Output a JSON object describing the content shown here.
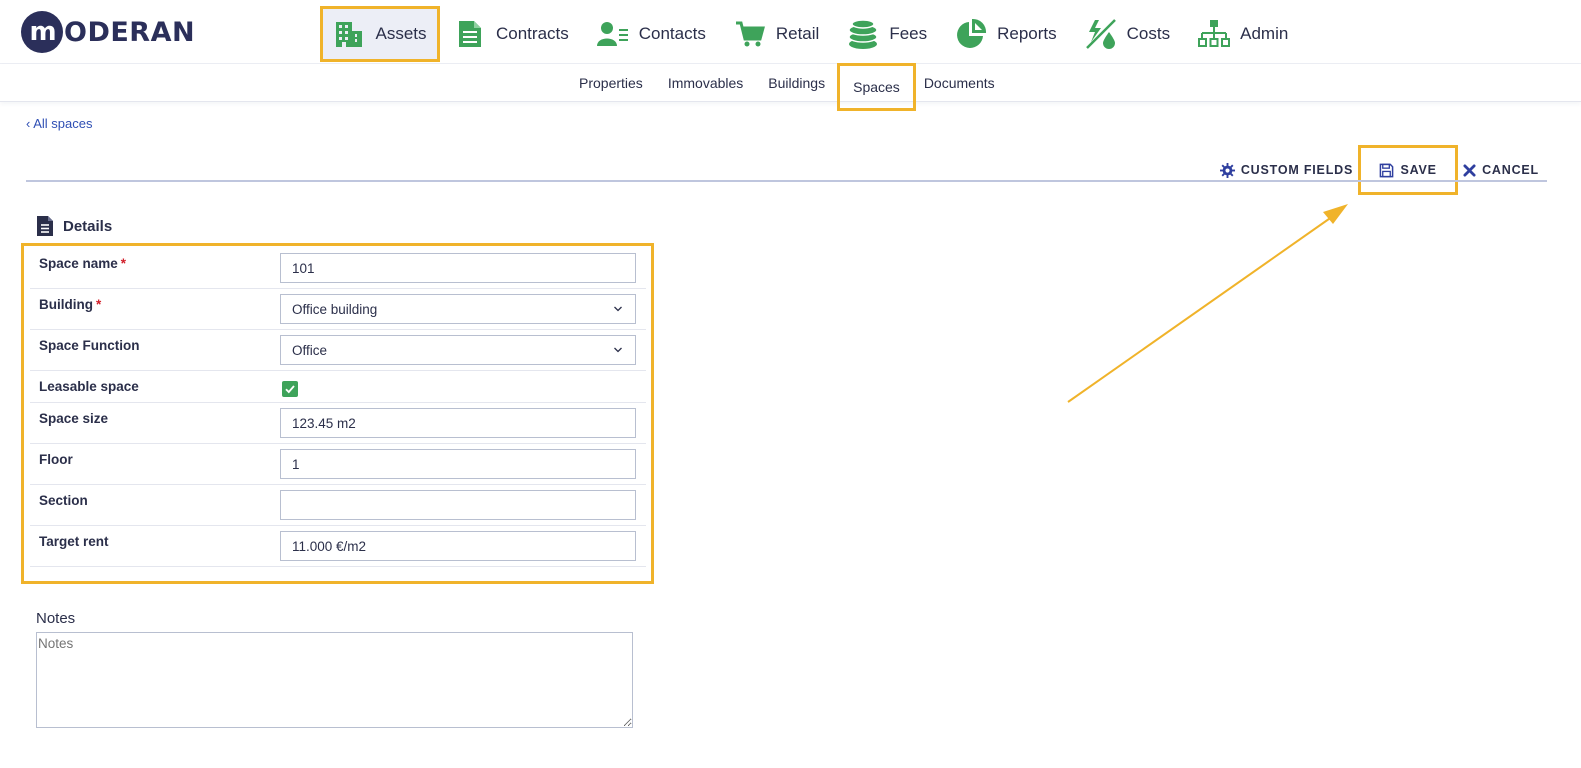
{
  "logo": {
    "mark": "m",
    "text": "ODERAN"
  },
  "main_nav": [
    {
      "label": "Assets",
      "icon": "building-icon",
      "active": true
    },
    {
      "label": "Contracts",
      "icon": "document-icon"
    },
    {
      "label": "Contacts",
      "icon": "contact-icon"
    },
    {
      "label": "Retail",
      "icon": "cart-icon"
    },
    {
      "label": "Fees",
      "icon": "coins-icon"
    },
    {
      "label": "Reports",
      "icon": "pie-chart-icon"
    },
    {
      "label": "Costs",
      "icon": "utilities-icon"
    },
    {
      "label": "Admin",
      "icon": "sitemap-icon"
    }
  ],
  "sub_nav": [
    {
      "label": "Properties"
    },
    {
      "label": "Immovables"
    },
    {
      "label": "Buildings"
    },
    {
      "label": "Spaces",
      "active": true
    },
    {
      "label": "Documents"
    }
  ],
  "back_link": "All spaces",
  "toolbar": {
    "custom_fields": "CUSTOM FIELDS",
    "save": "SAVE",
    "cancel": "CANCEL"
  },
  "details": {
    "title": "Details",
    "fields": [
      {
        "label": "Space name",
        "required": "*",
        "value": "101"
      },
      {
        "label": "Building",
        "required": "*",
        "value": "Office building"
      },
      {
        "label": "Space Function",
        "value": "Office"
      },
      {
        "label": "Leasable space",
        "checked": true
      },
      {
        "label": "Space size",
        "value": "123.45 m2"
      },
      {
        "label": "Floor",
        "value": "1"
      },
      {
        "label": "Section",
        "value": ""
      },
      {
        "label": "Target rent",
        "value": "11.000 €/m2"
      }
    ]
  },
  "notes": {
    "label": "Notes",
    "placeholder": "Notes"
  },
  "colors": {
    "accent_green": "#3ea35a",
    "brand_navy": "#2b2f5a",
    "highlight": "#f0b32a",
    "link_blue": "#2f4fb4"
  }
}
